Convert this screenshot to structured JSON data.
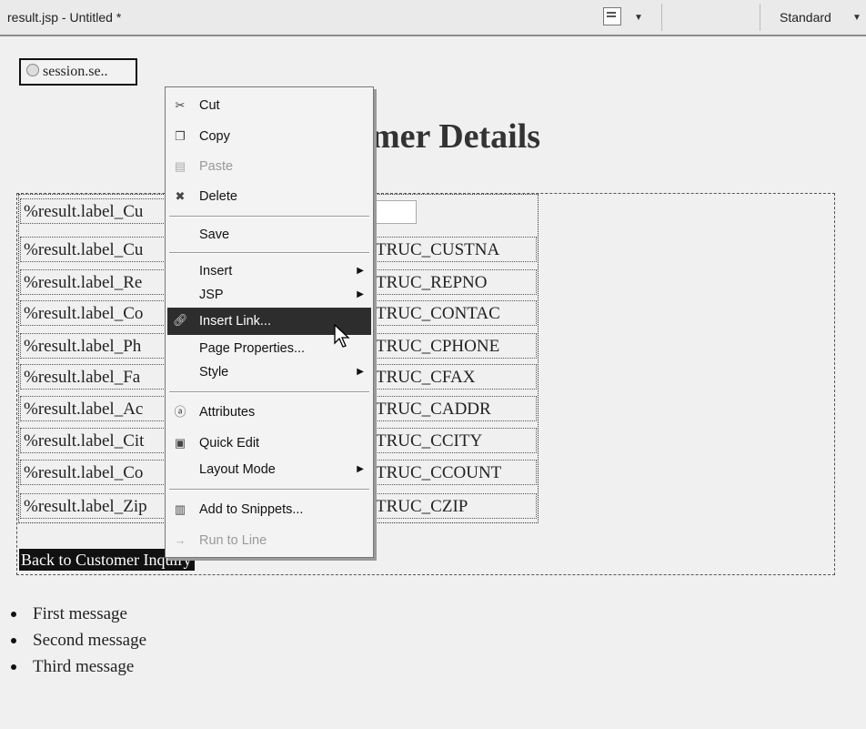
{
  "editor": {
    "title": "result.jsp - Untitled *",
    "mode_label": "Standard"
  },
  "page": {
    "session_tag": "session.se..",
    "heading": "mer Details",
    "rows": [
      {
        "label": "%result.label_Cu",
        "value": ""
      },
      {
        "label": "%result.label_Cu",
        "value": "TRUC_CUSTNA"
      },
      {
        "label": "%result.label_Re",
        "value": "TRUC_REPNO"
      },
      {
        "label": "%result.label_Co",
        "value": "TRUC_CONTAC"
      },
      {
        "label": "%result.label_Ph",
        "value": "TRUC_CPHONE"
      },
      {
        "label": "%result.label_Fa",
        "value": "TRUC_CFAX"
      },
      {
        "label": "%result.label_Ac",
        "value": "TRUC_CADDR"
      },
      {
        "label": "%result.label_Cit",
        "value": "TRUC_CCITY"
      },
      {
        "label": "%result.label_Co",
        "value": "TRUC_CCOUNT"
      },
      {
        "label": "%result.label_Zip",
        "value": "TRUC_CZIP"
      }
    ],
    "back_link": "Back to Customer Inquiry",
    "messages": [
      "First message",
      "Second message",
      "Third message"
    ]
  },
  "context_menu": {
    "items": [
      {
        "label": "Cut",
        "icon": "scissors-icon",
        "state": "enabled"
      },
      {
        "label": "Copy",
        "icon": "copy-icon",
        "state": "enabled"
      },
      {
        "label": "Paste",
        "icon": "paste-icon",
        "state": "disabled"
      },
      {
        "label": "Delete",
        "icon": "delete-icon",
        "state": "enabled"
      },
      {
        "label": "Save",
        "icon": "",
        "state": "enabled"
      },
      {
        "label": "Insert",
        "icon": "",
        "state": "submenu"
      },
      {
        "label": "JSP",
        "icon": "",
        "state": "submenu"
      },
      {
        "label": "Insert Link...",
        "icon": "link-icon",
        "state": "highlighted"
      },
      {
        "label": "Page Properties...",
        "icon": "",
        "state": "enabled"
      },
      {
        "label": "Style",
        "icon": "",
        "state": "submenu"
      },
      {
        "label": "Attributes",
        "icon": "attributes-icon",
        "state": "enabled"
      },
      {
        "label": "Quick Edit",
        "icon": "quick-edit-icon",
        "state": "enabled"
      },
      {
        "label": "Layout Mode",
        "icon": "",
        "state": "submenu"
      },
      {
        "label": "Add to Snippets...",
        "icon": "snippets-icon",
        "state": "enabled"
      },
      {
        "label": "Run to Line",
        "icon": "run-to-line-icon",
        "state": "disabled"
      }
    ]
  }
}
